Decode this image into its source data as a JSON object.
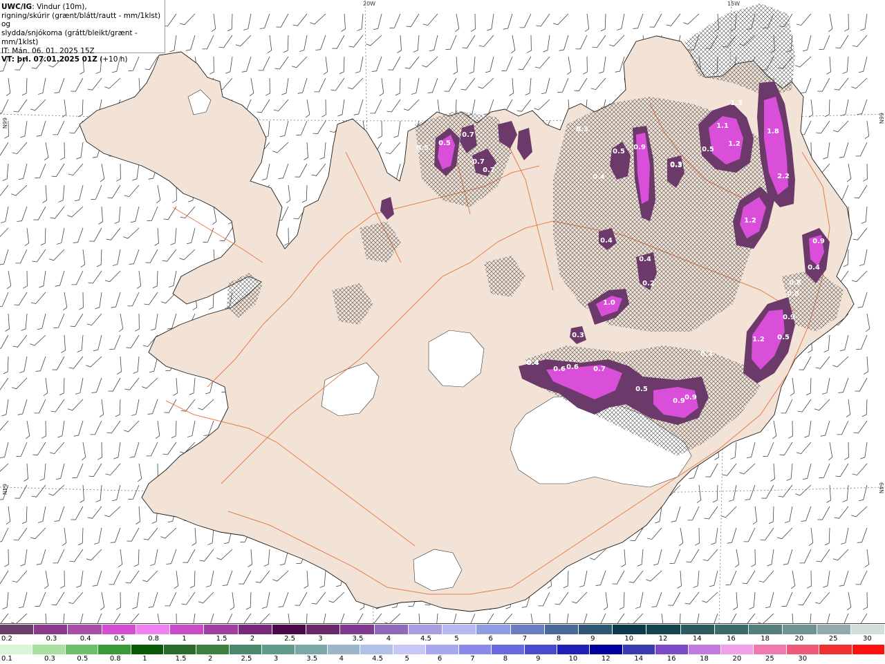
{
  "header": {
    "model_tag": "UWC/IG",
    "line1_rest": ": Vindur (10m),",
    "line2": "rigning/skúrir (grænt/blátt/rautt - mm/1klst) og",
    "line3": "slydda/snjókoma (grátt/bleikt/grænt - mm/1klst)",
    "line4": "IT: Mán. 06. 01. 2025 15Z",
    "line5_bold": "VT: þri. 07.01.2025 01Z",
    "line5_rest": " (+10 h)"
  },
  "graticule": {
    "lon_top": [
      "20W",
      "15W"
    ],
    "lat_left": [
      "66N",
      "64N"
    ],
    "lat_right": [
      "66N",
      "64N"
    ]
  },
  "colors": {
    "sea": "#ffffff",
    "land": "#f2e3d6",
    "coast": "#1a1a1a",
    "roads": "#e8703a",
    "snow_dark": "#6b3a6b",
    "snow_mid": "#9b3d9b",
    "snow_light": "#d94fd9",
    "snow_bright": "#f07ff0"
  },
  "precip_labels": [
    "0.5",
    "0.7",
    "0.7",
    "0.5",
    "0.9",
    "0.5",
    "0.3",
    "0.4",
    "1.1",
    "1.2",
    "0.5",
    "1.3",
    "1.8",
    "2.2",
    "1.2",
    "0.9",
    "0.4",
    "0.4",
    "0.4",
    "1.0",
    "0.3",
    "0.2",
    "0.8",
    "0.8",
    "0.9",
    "0.5",
    "1.2",
    "0.4",
    "0.6",
    "0.6",
    "0.7",
    "0.5",
    "0.9",
    "0.9",
    "0.3",
    "0.3",
    "0.7",
    "0.3",
    "0.4"
  ],
  "scale_top": {
    "colors": [
      "#6a3f6a",
      "#8b3a8b",
      "#a84ea8",
      "#d24fd2",
      "#f083f0",
      "#c84ec8",
      "#a03fa0",
      "#7a2a7a",
      "#4a0a4a",
      "#6a2a6a",
      "#7e3a8e",
      "#8e6ab8",
      "#a89ee0",
      "#b9b9f0",
      "#8f9ee0",
      "#6a7ec0",
      "#4a6b9a",
      "#2f5672",
      "#0d3a4a",
      "#13454e",
      "#2e5a5e",
      "#3c6b6b",
      "#557e7e",
      "#6f9292",
      "#94aaaa",
      "#d4dcdc"
    ],
    "labels": [
      "0.2",
      "0.3",
      "0.4",
      "0.5",
      "0.8",
      "1",
      "1.5",
      "2",
      "2.5",
      "3",
      "3.5",
      "4",
      "4.5",
      "5",
      "6",
      "7",
      "8",
      "9",
      "10",
      "12",
      "14",
      "16",
      "18",
      "20",
      "25",
      "30"
    ]
  },
  "scale_bottom": {
    "colors": [
      "#d8f5d8",
      "#a8e0a0",
      "#6cc06c",
      "#3a9a3a",
      "#0a5a0a",
      "#2a6a2a",
      "#3e7e3e",
      "#4a8a6a",
      "#5f9a8a",
      "#7aa8a8",
      "#9ab6c8",
      "#b0c0e8",
      "#c8c8f8",
      "#a8a8f0",
      "#8a8ae8",
      "#6a6ae0",
      "#4a4ad0",
      "#2020b8",
      "#0000a0",
      "#3a3ab0",
      "#7a4ac8",
      "#c07ae0",
      "#f0a0e8",
      "#f07ab0",
      "#f05a7a",
      "#f03030",
      "#ff1010"
    ],
    "labels": [
      "0.1",
      "0.3",
      "0.5",
      "0.8",
      "1",
      "1.5",
      "2",
      "2.5",
      "3",
      "3.5",
      "4",
      "4.5",
      "5",
      "6",
      "7",
      "8",
      "9",
      "10",
      "12",
      "14",
      "16",
      "18",
      "20",
      "25",
      "30"
    ]
  }
}
